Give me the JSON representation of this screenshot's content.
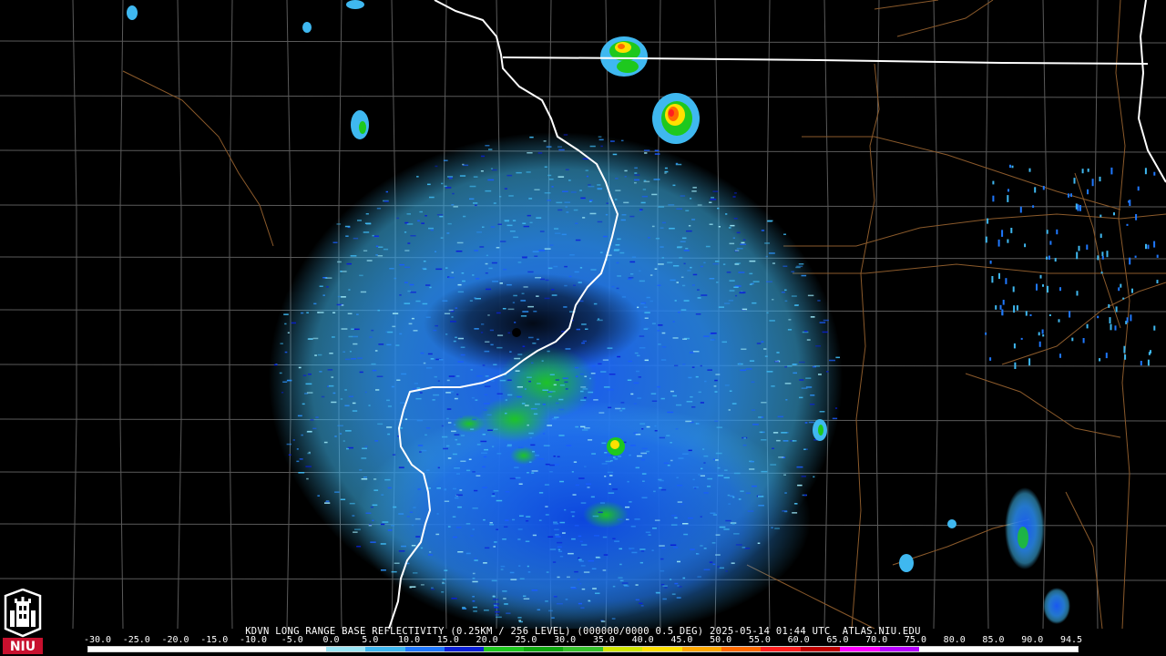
{
  "product": {
    "caption": "KDVN LONG RANGE BASE REFLECTIVITY (0.25KM / 256 LEVEL) (000000/0000 0.5 DEG) 2025-05-14 01:44 UTC  ATLAS.NIU.EDU"
  },
  "logo": {
    "text": "NIU",
    "icon": "niu-tower-shield-icon",
    "color": "#c8102e"
  },
  "scale": {
    "labels": [
      "-30.0",
      "-25.0",
      "-20.0",
      "-15.0",
      "-10.0",
      "-5.0",
      "0.0",
      "5.0",
      "10.0",
      "15.0",
      "20.0",
      "25.0",
      "30.0",
      "35.0",
      "40.0",
      "45.0",
      "50.0",
      "55.0",
      "60.0",
      "65.0",
      "70.0",
      "75.0",
      "80.0",
      "85.0",
      "90.0",
      "94.5"
    ],
    "colors": [
      "#ffffff",
      "#ffffff",
      "#ffffff",
      "#ffffff",
      "#ffffff",
      "#ffffff",
      "#9ce6f5",
      "#3fb8f0",
      "#1f78ff",
      "#0a1fd8",
      "#1ec81e",
      "#0ea80e",
      "#36c22c",
      "#d2e600",
      "#ffe000",
      "#ffa800",
      "#ff6a00",
      "#ff1f1f",
      "#c00000",
      "#ff00ff",
      "#b800ff",
      "#ffffff",
      "#ffffff",
      "#ffffff",
      "#ffffff"
    ]
  },
  "map_colors": {
    "background": "#000000",
    "county_lines": "#5a5a5a",
    "state_lines": "#ffffff",
    "roads": "#8b5a2b"
  }
}
